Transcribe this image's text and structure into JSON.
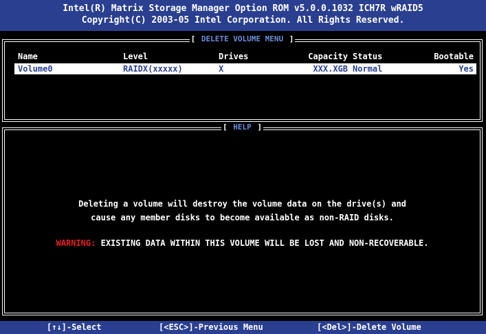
{
  "header": {
    "line1": "Intel(R) Matrix Storage Manager Option ROM v5.0.0.1032 ICH7R wRAID5",
    "line2": "Copyright(C) 2003-05 Intel Corporation. All Rights Reserved."
  },
  "delete_menu": {
    "title": "DELETE VOLUME MENU",
    "columns": {
      "name": "Name",
      "level": "Level",
      "drives": "Drives",
      "capacity": "Capacity",
      "status": "Status",
      "bootable": "Bootable"
    },
    "volumes": [
      {
        "name": "Volume0",
        "level": "RAIDX(xxxxx)",
        "drives": "X",
        "capacity": "XXX.XGB",
        "status": "Normal",
        "bootable": "Yes"
      }
    ]
  },
  "help": {
    "title": "HELP",
    "line1": "Deleting a volume will destroy the volume data on the drive(s) and",
    "line2": "cause any member disks to become available as non-RAID disks.",
    "warning_label": "WARNING:",
    "warning_text": "EXISTING DATA WITHIN THIS VOLUME WILL BE LOST AND NON-RECOVERABLE."
  },
  "footer": {
    "select": "[↑↓]-Select",
    "esc": "[<ESC>]-Previous Menu",
    "del": "[<Del>]-Delete Volume"
  },
  "colors": {
    "header_bg": "#2a3f8f",
    "warning": "#e52020",
    "selected_row_bg": "#ffffff",
    "selected_row_text": "#2a3f8f"
  }
}
